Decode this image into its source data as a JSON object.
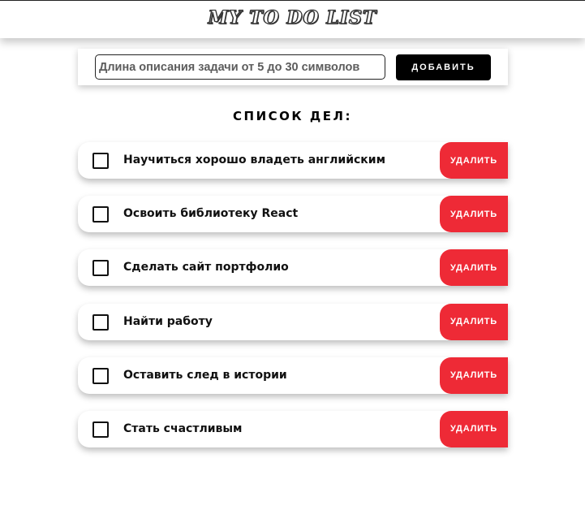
{
  "header": {
    "title": "My To Do List"
  },
  "add_form": {
    "input_placeholder": "Длина описания задачи от 5 до 30 символов",
    "input_value": "",
    "add_button_label": "ДОБАВИТЬ"
  },
  "list": {
    "title": "СПИСОК ДЕЛ:",
    "items": [
      {
        "text": "Научиться хорошо владеть английским",
        "checked": false,
        "delete_label": "УДАЛИТЬ"
      },
      {
        "text": "Освоить библиотеку React",
        "checked": false,
        "delete_label": "УДАЛИТЬ"
      },
      {
        "text": "Сделать сайт портфолио",
        "checked": false,
        "delete_label": "УДАЛИТЬ"
      },
      {
        "text": "Найти работу",
        "checked": false,
        "delete_label": "УДАЛИТЬ"
      },
      {
        "text": "Оставить след в истории",
        "checked": false,
        "delete_label": "УДАЛИТЬ"
      },
      {
        "text": "Стать счастливым",
        "checked": false,
        "delete_label": "УДАЛИТЬ"
      }
    ]
  },
  "colors": {
    "delete_button": "#ee2a36",
    "add_button": "#000000",
    "background": "#ffffff"
  }
}
